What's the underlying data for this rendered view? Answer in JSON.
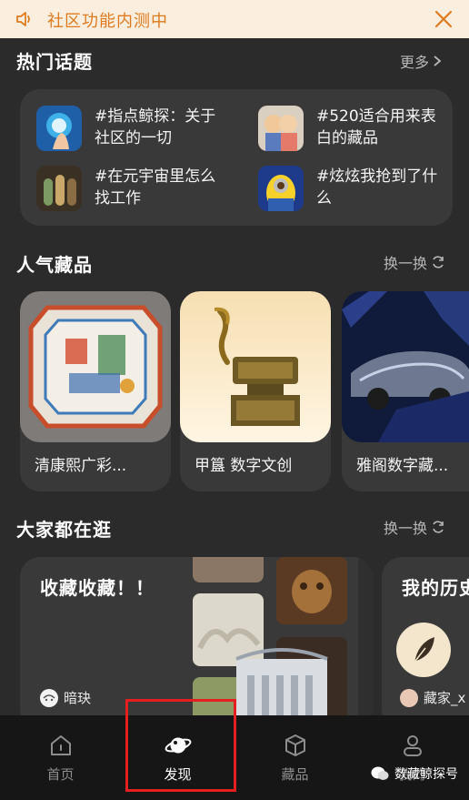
{
  "notice": {
    "text": "社区功能内测中"
  },
  "hot_topics": {
    "title": "热门话题",
    "more": "更多",
    "items": [
      {
        "label": "#指点鲸探：关于社区的一切"
      },
      {
        "label": "#520适合用来表白的藏品"
      },
      {
        "label": "#在元宇宙里怎么找工作"
      },
      {
        "label": "#炫炫我抢到了什么"
      }
    ]
  },
  "popular": {
    "title": "人气藏品",
    "refresh": "换一换",
    "items": [
      {
        "name": "清康熙广彩..."
      },
      {
        "name": "甲簋 数字文创"
      },
      {
        "name": "雅阁数字藏..."
      }
    ]
  },
  "browse": {
    "title": "大家都在逛",
    "refresh": "换一换",
    "cards": [
      {
        "title": "收藏收藏！！",
        "user": "暗玦"
      },
      {
        "title": "我的历史",
        "user": "藏家_x"
      }
    ]
  },
  "tabbar": {
    "items": [
      {
        "label": "首页",
        "icon": "home-icon"
      },
      {
        "label": "发现",
        "icon": "planet-icon",
        "active": true
      },
      {
        "label": "藏品",
        "icon": "cube-icon"
      },
      {
        "label": "我的",
        "icon": "person-icon"
      }
    ]
  },
  "watermark": {
    "text": "数藏鲸探号"
  },
  "colors": {
    "accent": "#e07a1f",
    "background": "#2b2b2b",
    "card": "#393939",
    "highlight": "#e41f1f"
  }
}
